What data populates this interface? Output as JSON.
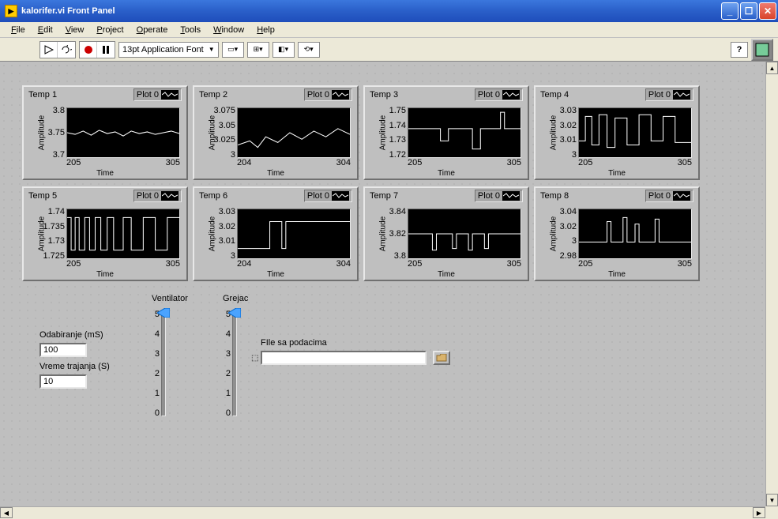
{
  "window": {
    "title": "kalorifer.vi Front Panel"
  },
  "menu": {
    "file": "File",
    "edit": "Edit",
    "view": "View",
    "project": "Project",
    "operate": "Operate",
    "tools": "Tools",
    "window": "Window",
    "help": "Help"
  },
  "toolbar": {
    "font": "13pt Application Font",
    "help": "?"
  },
  "charts": [
    {
      "title": "Temp 1",
      "legend": "Plot 0",
      "ylabel": "Amplitude",
      "xlabel": "Time",
      "yticks": [
        "3.8",
        "3.75",
        "3.7"
      ],
      "xticks": [
        "205",
        "305"
      ]
    },
    {
      "title": "Temp 2",
      "legend": "Plot 0",
      "ylabel": "Amplitude",
      "xlabel": "Time",
      "yticks": [
        "3.075",
        "3.05",
        "3.025",
        "3"
      ],
      "xticks": [
        "204",
        "304"
      ]
    },
    {
      "title": "Temp 3",
      "legend": "Plot 0",
      "ylabel": "Amplitude",
      "xlabel": "Time",
      "yticks": [
        "1.75",
        "1.74",
        "1.73",
        "1.72"
      ],
      "xticks": [
        "205",
        "305"
      ]
    },
    {
      "title": "Temp 4",
      "legend": "Plot 0",
      "ylabel": "Amplitude",
      "xlabel": "Time",
      "yticks": [
        "3.03",
        "3.02",
        "3.01",
        "3"
      ],
      "xticks": [
        "205",
        "305"
      ]
    },
    {
      "title": "Temp 5",
      "legend": "Plot 0",
      "ylabel": "Amplitude",
      "xlabel": "Time",
      "yticks": [
        "1.74",
        "1.735",
        "1.73",
        "1.725"
      ],
      "xticks": [
        "205",
        "305"
      ]
    },
    {
      "title": "Temp 6",
      "legend": "Plot 0",
      "ylabel": "Amplitude",
      "xlabel": "Time",
      "yticks": [
        "3.03",
        "3.02",
        "3.01",
        "3"
      ],
      "xticks": [
        "204",
        "304"
      ]
    },
    {
      "title": "Temp 7",
      "legend": "Plot 0",
      "ylabel": "Amplitude",
      "xlabel": "Time",
      "yticks": [
        "3.84",
        "3.82",
        "3.8"
      ],
      "xticks": [
        "205",
        "305"
      ]
    },
    {
      "title": "Temp 8",
      "legend": "Plot 0",
      "ylabel": "Amplitude",
      "xlabel": "Time",
      "yticks": [
        "3.04",
        "3.02",
        "3",
        "2.98"
      ],
      "xticks": [
        "205",
        "305"
      ]
    }
  ],
  "controls": {
    "odabiranje_label": "Odabiranje (mS)",
    "odabiranje_value": "100",
    "vreme_label": "Vreme trajanja (S)",
    "vreme_value": "10",
    "ventilator_label": "Ventilator",
    "grejac_label": "Grejac",
    "slider_ticks": [
      "5",
      "4",
      "3",
      "2",
      "1",
      "0"
    ],
    "file_label": "FIle sa podacima",
    "file_value": ""
  },
  "chart_data": [
    {
      "type": "line",
      "title": "Temp 1",
      "xlabel": "Time",
      "ylabel": "Amplitude",
      "x_range": [
        205,
        305
      ],
      "y_range": [
        3.7,
        3.8
      ],
      "series": [
        {
          "name": "Plot 0",
          "approx_mean": 3.75,
          "note": "noisy around 3.75"
        }
      ]
    },
    {
      "type": "line",
      "title": "Temp 2",
      "xlabel": "Time",
      "ylabel": "Amplitude",
      "x_range": [
        204,
        304
      ],
      "y_range": [
        3.0,
        3.075
      ],
      "series": [
        {
          "name": "Plot 0",
          "approx_mean": 3.04,
          "note": "rises slightly, noisy"
        }
      ]
    },
    {
      "type": "line",
      "title": "Temp 3",
      "xlabel": "Time",
      "ylabel": "Amplitude",
      "x_range": [
        205,
        305
      ],
      "y_range": [
        1.72,
        1.75
      ],
      "series": [
        {
          "name": "Plot 0",
          "approx_mean": 1.735,
          "note": "flat segment then spikes"
        }
      ]
    },
    {
      "type": "line",
      "title": "Temp 4",
      "xlabel": "Time",
      "ylabel": "Amplitude",
      "x_range": [
        205,
        305
      ],
      "y_range": [
        3.0,
        3.03
      ],
      "series": [
        {
          "name": "Plot 0",
          "approx_mean": 3.015,
          "note": "noisy rectangular pulses"
        }
      ]
    },
    {
      "type": "line",
      "title": "Temp 5",
      "xlabel": "Time",
      "ylabel": "Amplitude",
      "x_range": [
        205,
        305
      ],
      "y_range": [
        1.725,
        1.74
      ],
      "series": [
        {
          "name": "Plot 0",
          "approx_mean": 1.733,
          "note": "dense rectangular pulses"
        }
      ]
    },
    {
      "type": "line",
      "title": "Temp 6",
      "xlabel": "Time",
      "ylabel": "Amplitude",
      "x_range": [
        204,
        304
      ],
      "y_range": [
        3.0,
        3.03
      ],
      "series": [
        {
          "name": "Plot 0",
          "approx_mean": 3.015,
          "note": "step up around x≈240"
        }
      ]
    },
    {
      "type": "line",
      "title": "Temp 7",
      "xlabel": "Time",
      "ylabel": "Amplitude",
      "x_range": [
        205,
        305
      ],
      "y_range": [
        3.8,
        3.84
      ],
      "series": [
        {
          "name": "Plot 0",
          "approx_mean": 3.82,
          "note": "mostly flat at 3.82 with downward spikes"
        }
      ]
    },
    {
      "type": "line",
      "title": "Temp 8",
      "xlabel": "Time",
      "ylabel": "Amplitude",
      "x_range": [
        205,
        305
      ],
      "y_range": [
        2.98,
        3.04
      ],
      "series": [
        {
          "name": "Plot 0",
          "approx_mean": 3.01,
          "note": "flat at 3.0 with upward spikes"
        }
      ]
    }
  ]
}
